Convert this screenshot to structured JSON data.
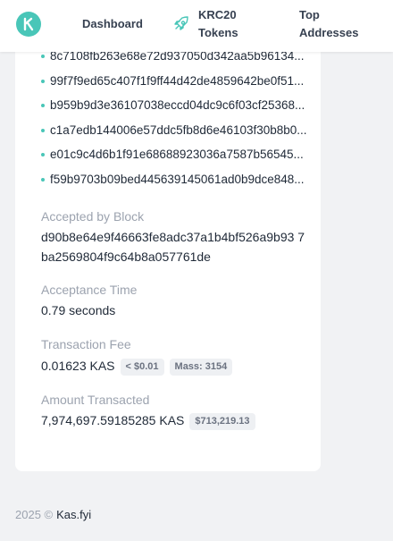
{
  "header": {
    "nav": [
      {
        "label": "Dashboard"
      },
      {
        "label": "KRC20 Tokens"
      },
      {
        "label": "Top Addresses"
      }
    ]
  },
  "transaction": {
    "hashes": [
      "8c7108fb263e68e72d937050d342aa5b96134...",
      "99f7f9ed65c407f1f9ff44d42de4859642be0f51...",
      "b959b9d3e36107038eccd04dc9c6f03cf25368...",
      "c1a7edb144006e57ddc5fb8d6e46103f30b8b0...",
      "e01c9c4d6b1f91e68688923036a7587b56545...",
      "f59b9703b09bed445639145061ad0b9dce848..."
    ],
    "accepted_by_block": {
      "label": "Accepted by Block",
      "value": "d90b8e64e9f46663fe8adc37a1b4bf526a9b93 7ba2569804f9c64b8a057761de"
    },
    "acceptance_time": {
      "label": "Acceptance Time",
      "value": "0.79 seconds"
    },
    "fee": {
      "label": "Transaction Fee",
      "value": "0.01623 KAS",
      "usd_badge": "< $0.01",
      "mass_badge": "Mass: 3154"
    },
    "amount": {
      "label": "Amount Transacted",
      "value": "7,974,697.59185285 KAS",
      "usd_badge": "$713,219.13"
    }
  },
  "footer": {
    "copyright": "2025 ©",
    "link": "Kas.fyi"
  },
  "colors": {
    "accent": "#49c6b8",
    "background": "#f1f2f4"
  }
}
